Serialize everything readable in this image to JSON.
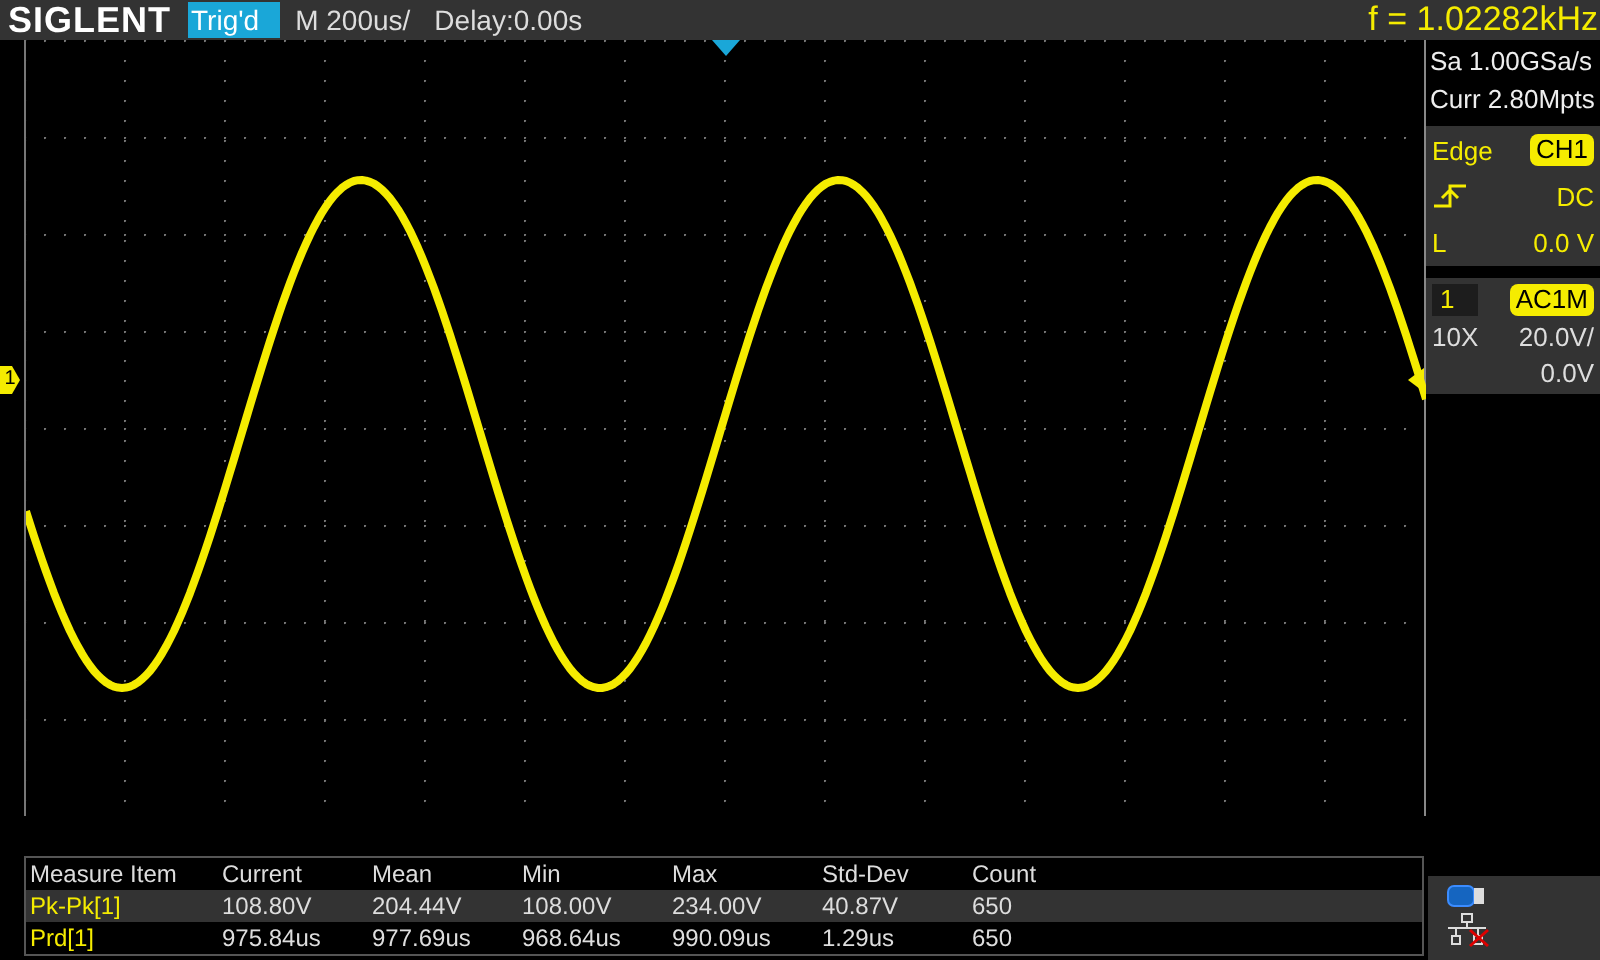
{
  "header": {
    "logo": "SIGLENT",
    "trigger_status": "Trig'd",
    "timebase": "M 200us/",
    "delay": "Delay:0.00s",
    "frequency": "f = 1.02282kHz"
  },
  "display": {
    "channel_marker": "1"
  },
  "acquisition": {
    "sample_rate": "Sa 1.00GSa/s",
    "memory_depth": "Curr 2.80Mpts"
  },
  "trigger": {
    "type": "Edge",
    "source": "CH1",
    "coupling": "DC",
    "level_label": "L",
    "level": "0.0 V"
  },
  "channel": {
    "number": "1",
    "coupling": "AC1M",
    "probe": "10X",
    "scale": "20.0V/",
    "offset": "0.0V"
  },
  "measurements": {
    "columns": [
      "Measure Item",
      "Current",
      "Mean",
      "Min",
      "Max",
      "Std-Dev",
      "Count"
    ],
    "rows": [
      {
        "name": "Pk-Pk[1]",
        "values": [
          "108.80V",
          "204.44V",
          "108.00V",
          "234.00V",
          "40.87V",
          "650"
        ]
      },
      {
        "name": "Prd[1]",
        "values": [
          "975.84us",
          "977.69us",
          "968.64us",
          "990.09us",
          "1.29us",
          "650"
        ]
      }
    ]
  }
}
